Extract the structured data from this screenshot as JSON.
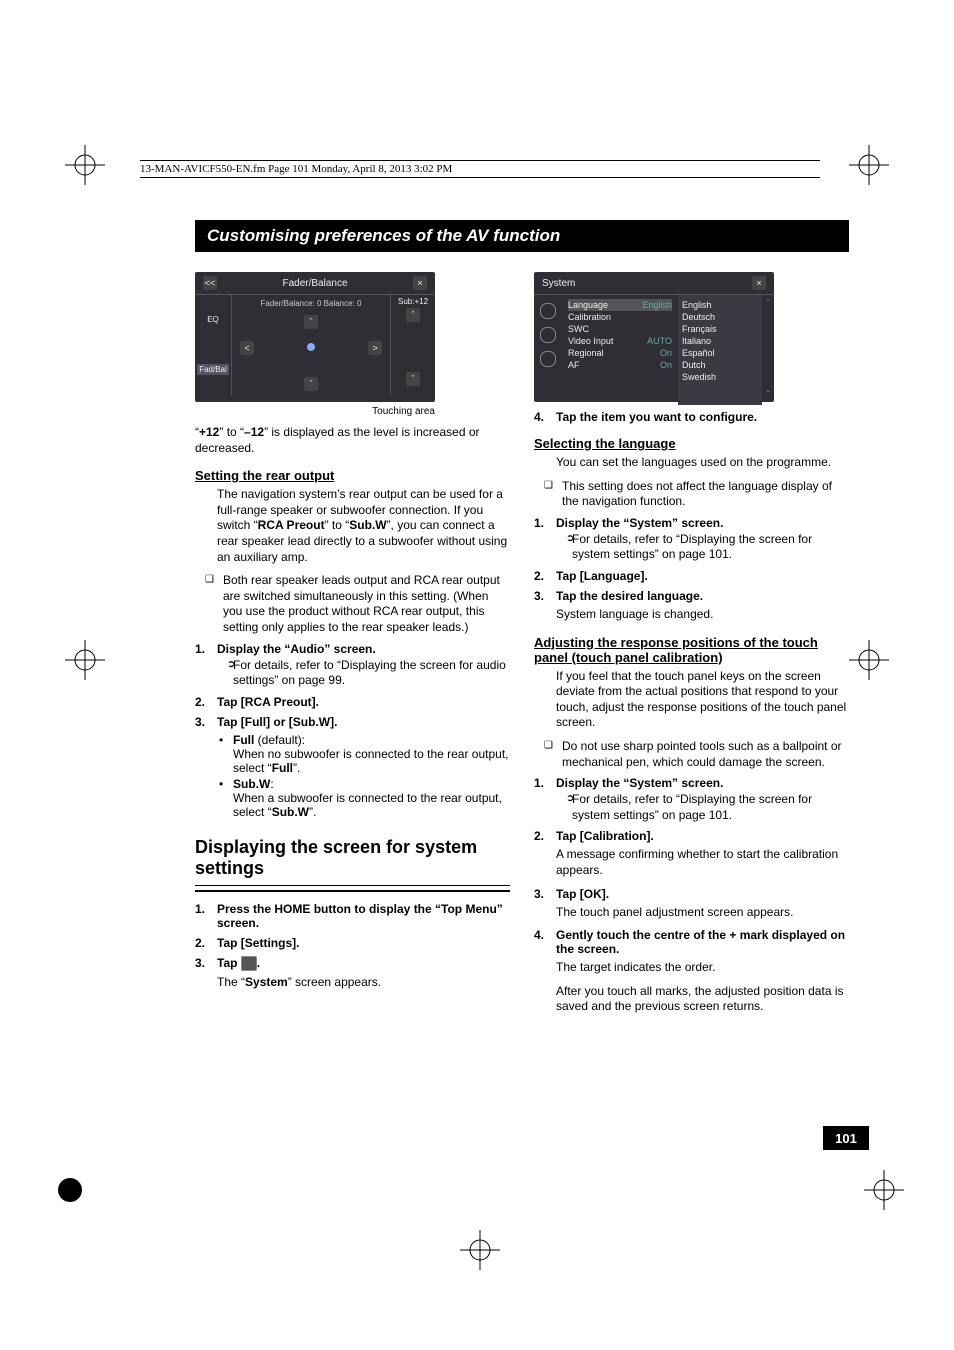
{
  "fm_header": "13-MAN-AVICF550-EN.fm  Page 101  Monday, April 8, 2013  3:02 PM",
  "section_bar": "Customising preferences of the AV function",
  "shot1": {
    "title": "Fader/Balance",
    "sub": "Fader/Balance: 0  Balance: 0",
    "subright": "Sub:+12",
    "side1": "EQ",
    "side2": "Fad/Bal",
    "back": "<<",
    "close": "×",
    "up": "ˆ",
    "down": "ˇ",
    "left": "<",
    "right": ">"
  },
  "touching_label": "Touching area",
  "fader_level_text_pre": "“",
  "fader_level_plus": "+12",
  "fader_level_mid": "” to “",
  "fader_level_minus": "–12",
  "fader_level_post": "” is displayed as the level is increased or decreased.",
  "rear_heading": "Setting the rear output",
  "rear_p1a": "The navigation system’s rear output can be used for a full-range speaker or subwoofer connection. If you switch “",
  "rear_p1b": "RCA Preout",
  "rear_p1c": "” to “",
  "rear_p1d": "Sub.W",
  "rear_p1e": "”, you can connect a rear speaker lead directly to a subwoofer without using an auxiliary amp.",
  "rear_note": "Both rear speaker leads output and RCA rear output are switched simultaneously in this setting. (When you use the product without RCA rear output, this setting only applies to the rear speaker leads.)",
  "rear_step1": "Display the “Audio” screen.",
  "rear_step1_sub": "For details, refer to “Displaying the screen for audio settings” on page 99.",
  "rear_step2": "Tap [RCA Preout].",
  "rear_step3": "Tap [Full] or [Sub.W].",
  "rear_full_label": "Full",
  "rear_full_default": " (default):",
  "rear_full_desc_a": "When no subwoofer is connected to the rear output, select “",
  "rear_full_desc_b": "Full",
  "rear_full_desc_c": "”.",
  "rear_subw_label": "Sub.W",
  "rear_subw_colon": ":",
  "rear_subw_desc_a": "When a subwoofer is connected to the rear output, select “",
  "rear_subw_desc_b": "Sub.W",
  "rear_subw_desc_c": "”.",
  "sys_h2": "Displaying the screen for system settings",
  "sys_step1": "Press the HOME button to display the “Top Menu” screen.",
  "sys_step2": "Tap [Settings].",
  "sys_step3_pre": "Tap ",
  "sys_step3_post": ".",
  "sys_step3_line_a": "The “",
  "sys_step3_line_b": "System",
  "sys_step3_line_c": "” screen appears.",
  "shot2": {
    "title": "System",
    "close": "×",
    "rows": [
      {
        "label": "Language",
        "val": "English"
      },
      {
        "label": "Calibration",
        "val": ""
      },
      {
        "label": "SWC",
        "val": ""
      },
      {
        "label": "Video Input",
        "val": "AUTO"
      },
      {
        "label": "Regional",
        "val": "On"
      },
      {
        "label": "AF",
        "val": "On"
      }
    ],
    "langs": [
      "English",
      "Deutsch",
      "Français",
      "Italiano",
      "Español",
      "Dutch",
      "Swedish"
    ],
    "up": "ˆ",
    "down": "ˇ"
  },
  "sys_step4": "Tap the item you want to configure.",
  "lang_heading": "Selecting the language",
  "lang_p1": "You can set the languages used on the programme.",
  "lang_note": "This setting does not affect the language display of the navigation function.",
  "lang_step1": "Display the “System” screen.",
  "lang_step1_sub": "For details, refer to “Displaying the screen for system settings” on page 101.",
  "lang_step2": "Tap [Language].",
  "lang_step3": "Tap the desired language.",
  "lang_step3_line": "System language is changed.",
  "cal_heading": "Adjusting the response positions of the touch panel (touch panel calibration)",
  "cal_p1": "If you feel that the touch panel keys on the screen deviate from the actual positions that respond to your touch, adjust the response positions of the touch panel screen.",
  "cal_note": "Do not use sharp pointed tools such as a ballpoint or mechanical pen, which could damage the screen.",
  "cal_step1": "Display the “System” screen.",
  "cal_step1_sub": "For details, refer to “Displaying the screen for system settings” on page 101.",
  "cal_step2": "Tap [Calibration].",
  "cal_step2_line": "A message confirming whether to start the calibration appears.",
  "cal_step3": "Tap [OK].",
  "cal_step3_line": "The touch panel adjustment screen appears.",
  "cal_step4": "Gently touch the centre of the + mark displayed on the screen.",
  "cal_step4_line1": "The target indicates the order.",
  "cal_step4_line2": "After you touch all marks, the adjusted position data is saved and the previous screen returns.",
  "page_number": "101"
}
